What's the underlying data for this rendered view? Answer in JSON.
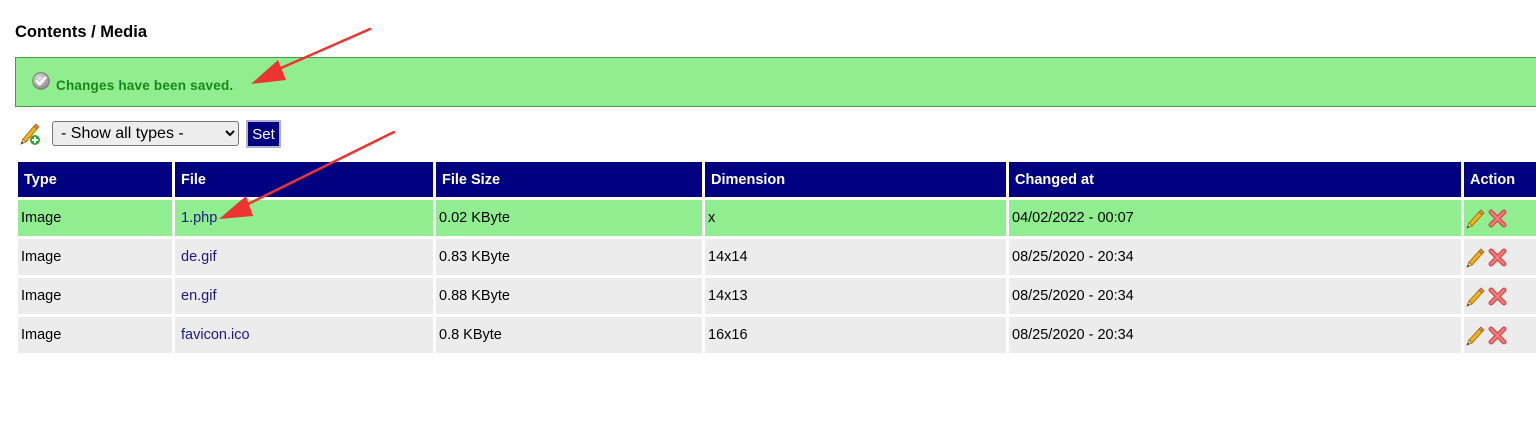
{
  "header": {
    "title": "Contents / Media"
  },
  "notice": {
    "message": "Changes have been saved.",
    "icon": "check-circle-icon",
    "background": "#90ee90",
    "text_color": "#168a16"
  },
  "toolbar": {
    "add_icon": "pencil-plus-icon",
    "type_filter": {
      "selected": "- Show all types -"
    },
    "set_label": "Set"
  },
  "table": {
    "header_color": "#000080",
    "columns": [
      "Type",
      "File",
      "File Size",
      "Dimension",
      "Changed at",
      "Action"
    ],
    "rows": [
      {
        "type": "Image",
        "file": "1.php",
        "size": "0.02 KByte",
        "dimension": "x",
        "changed": "04/02/2022 - 00:07",
        "highlight": true
      },
      {
        "type": "Image",
        "file": "de.gif",
        "size": "0.83 KByte",
        "dimension": "14x14",
        "changed": "08/25/2020 - 20:34",
        "highlight": false
      },
      {
        "type": "Image",
        "file": "en.gif",
        "size": "0.88 KByte",
        "dimension": "14x13",
        "changed": "08/25/2020 - 20:34",
        "highlight": false
      },
      {
        "type": "Image",
        "file": "favicon.ico",
        "size": "0.8 KByte",
        "dimension": "16x16",
        "changed": "08/25/2020 - 20:34",
        "highlight": false
      }
    ],
    "row_actions": [
      "edit-pencil-icon",
      "delete-x-icon"
    ]
  },
  "annotations": {
    "arrow_color": "#ee3333"
  }
}
